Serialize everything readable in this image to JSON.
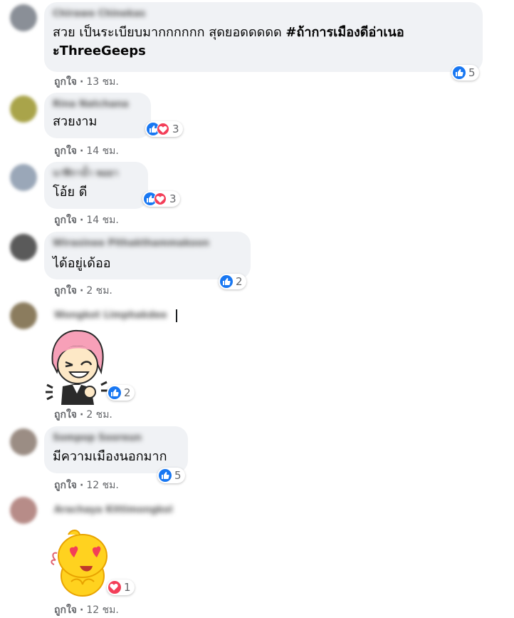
{
  "like_label": "ถูกใจ",
  "separator": "·",
  "colors": {
    "like_blue": "#1877f2",
    "love_red": "#f33e58",
    "bubble_bg": "#f0f2f5",
    "meta_gray": "#65676b"
  },
  "comments": [
    {
      "author": "Chirawe Chinekas",
      "text": "สวย เป็นระเบียบมากกกกกก สุดยอดดดดด ",
      "hashtag": "#ถ้าการเมืองดีอ่าเนอ",
      "text_line2": "ะThreeGeeps",
      "time": "13 ชม.",
      "reaction_icons": [
        "like-icon"
      ],
      "reaction_count": "5"
    },
    {
      "author": "Rina Natchana",
      "text": "สวยงาม",
      "time": "14 ชม.",
      "reaction_icons": [
        "like-icon",
        "love-icon"
      ],
      "reaction_count": "3"
    },
    {
      "author": "นาฬิกาน้ำ พอยา",
      "text": "โอ้ย ดี",
      "time": "14 ชม.",
      "reaction_icons": [
        "like-icon",
        "love-icon"
      ],
      "reaction_count": "3"
    },
    {
      "author": "Wirasinee Pithakthammakoon",
      "text": "ได้อยู่เด้ออ",
      "time": "2 ชม.",
      "reaction_icons": [
        "like-icon"
      ],
      "reaction_count": "2"
    },
    {
      "author": "Wongkot Limphakdee",
      "sticker": "pink-hair-girl-sticker",
      "time": "2 ชม.",
      "reaction_icons": [
        "like-icon"
      ],
      "reaction_count": "2"
    },
    {
      "author": "Sompop Sooreun",
      "text": "มีความเมืองนอกมาก",
      "time": "12 ชม.",
      "reaction_icons": [
        "like-icon"
      ],
      "reaction_count": "5"
    },
    {
      "author": "Arachaya Kittimongkol",
      "sticker": "yellow-heart-eyes-sticker",
      "time": "12 ชม.",
      "reaction_icons": [
        "love-icon"
      ],
      "reaction_count": "1"
    }
  ]
}
